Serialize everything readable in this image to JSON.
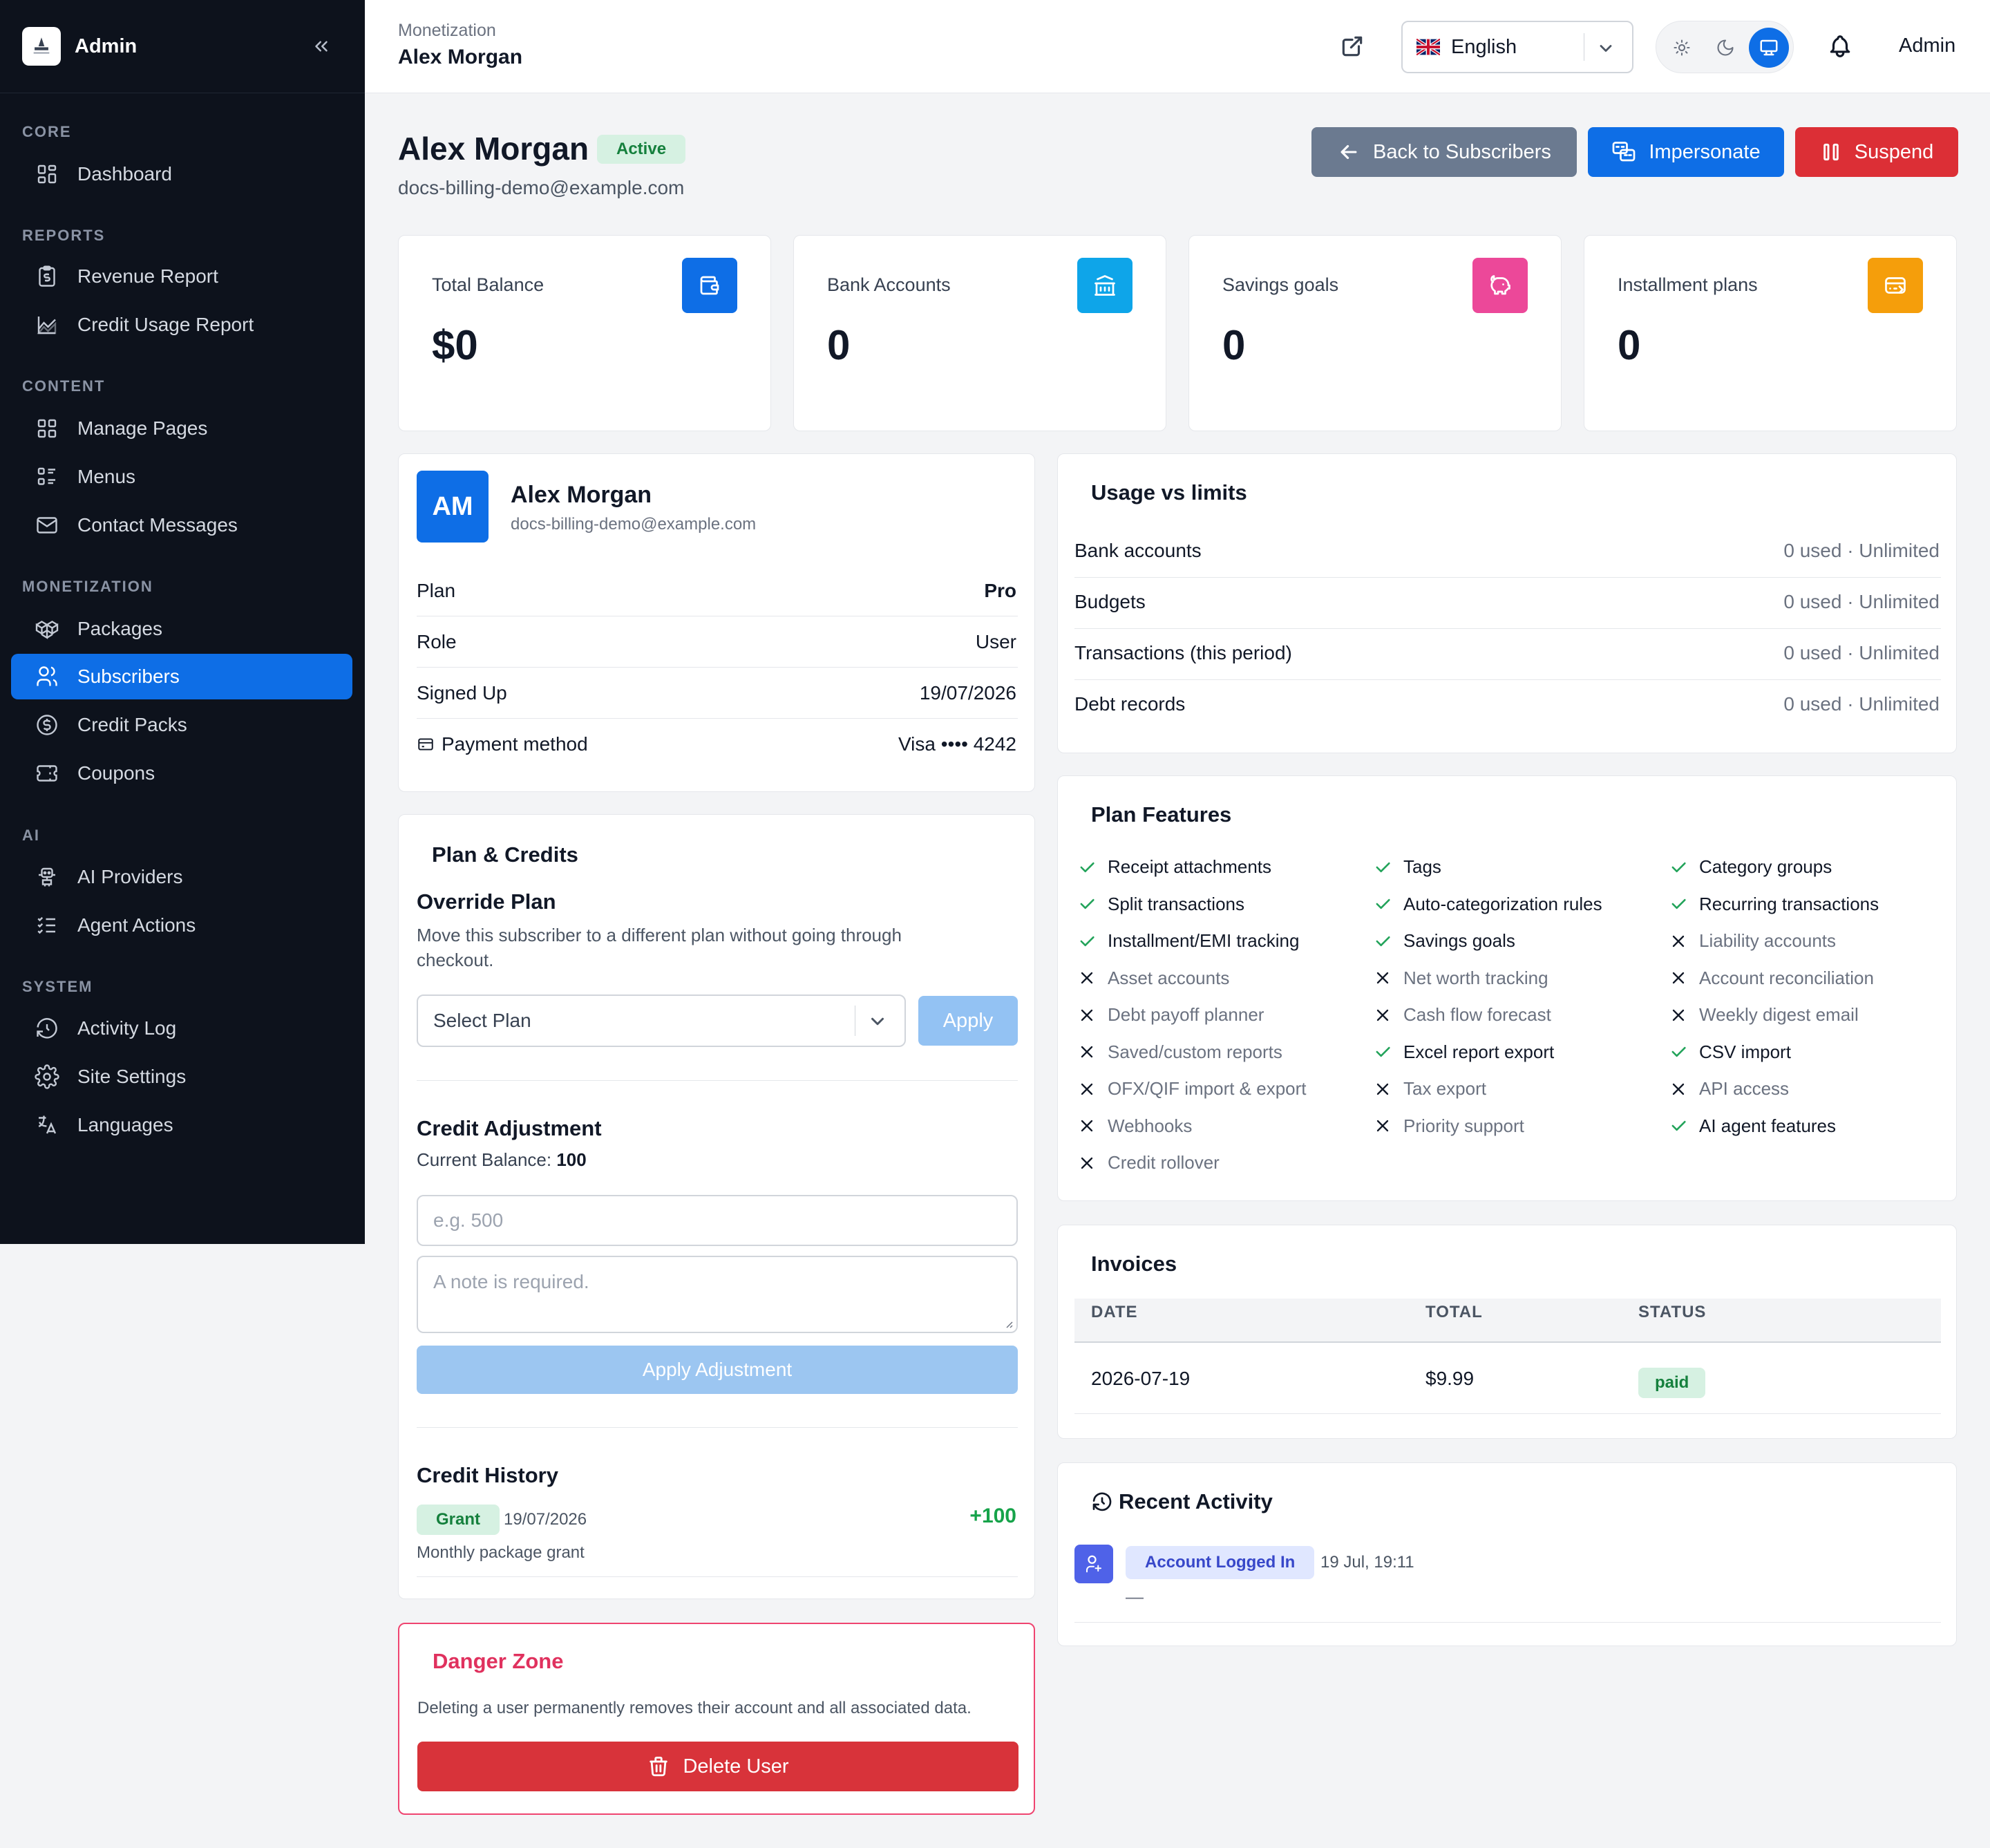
{
  "sidebar": {
    "title": "Admin",
    "sections": {
      "core": "CORE",
      "reports": "REPORTS",
      "content": "CONTENT",
      "monetization": "MONETIZATION",
      "ai": "AI",
      "system": "SYSTEM"
    },
    "items": {
      "dashboard": "Dashboard",
      "revenue": "Revenue Report",
      "credit_usage": "Credit Usage Report",
      "pages": "Manage Pages",
      "menus": "Menus",
      "contact": "Contact Messages",
      "packages": "Packages",
      "subscribers": "Subscribers",
      "credit_packs": "Credit Packs",
      "coupons": "Coupons",
      "ai_providers": "AI Providers",
      "agent_actions": "Agent Actions",
      "activity_log": "Activity Log",
      "site_settings": "Site Settings",
      "languages": "Languages"
    },
    "active_item": "Subscribers"
  },
  "topbar": {
    "breadcrumb": "Monetization",
    "page_name": "Alex Morgan",
    "language": "English",
    "theme_active": "system",
    "user": "Admin"
  },
  "header": {
    "name": "Alex Morgan",
    "status": "Active",
    "email": "docs-billing-demo@example.com",
    "buttons": {
      "back": "Back to Subscribers",
      "impersonate": "Impersonate",
      "suspend": "Suspend"
    }
  },
  "stats": [
    {
      "label": "Total Balance",
      "value": "$0",
      "icon": "wallet-icon",
      "color": "#0e6ee6"
    },
    {
      "label": "Bank Accounts",
      "value": "0",
      "icon": "bank-icon",
      "color": "#0ea5e9"
    },
    {
      "label": "Savings goals",
      "value": "0",
      "icon": "piggy-bank-icon",
      "color": "#ec4899"
    },
    {
      "label": "Installment plans",
      "value": "0",
      "icon": "card-transfer-icon",
      "color": "#f59e0b"
    }
  ],
  "profile": {
    "initials": "AM",
    "name": "Alex Morgan",
    "email": "docs-billing-demo@example.com",
    "rows": [
      {
        "label": "Plan",
        "value": "Pro"
      },
      {
        "label": "Role",
        "value": "User"
      },
      {
        "label": "Signed Up",
        "value": "19/07/2026"
      },
      {
        "label": "Payment method",
        "value": "Visa •••• 4242"
      }
    ]
  },
  "plan_credits": {
    "title": "Plan & Credits",
    "override_title": "Override Plan",
    "override_desc_line1": "Move this subscriber to a different plan without going through",
    "override_desc_line2": "checkout.",
    "select_placeholder": "Select Plan",
    "apply_label": "Apply",
    "adjust_title": "Credit Adjustment",
    "balance_label": "Current Balance:",
    "balance_value": "100",
    "amount_placeholder": "e.g. 500",
    "note_placeholder": "A note is required.",
    "apply_adjust_label": "Apply Adjustment",
    "history_title": "Credit History",
    "history": [
      {
        "type": "Grant",
        "date": "19/07/2026",
        "amount": "+100",
        "note": "Monthly package grant"
      }
    ]
  },
  "danger": {
    "title": "Danger Zone",
    "desc": "Deleting a user permanently removes their account and all associated data.",
    "button": "Delete User"
  },
  "usage": {
    "title": "Usage vs limits",
    "rows": [
      {
        "label": "Bank accounts",
        "value": "0 used · Unlimited"
      },
      {
        "label": "Budgets",
        "value": "0 used · Unlimited"
      },
      {
        "label": "Transactions (this period)",
        "value": "0 used · Unlimited"
      },
      {
        "label": "Debt records",
        "value": "0 used · Unlimited"
      }
    ]
  },
  "features": {
    "title": "Plan Features",
    "items": [
      {
        "label": "Receipt attachments",
        "enabled": true
      },
      {
        "label": "Tags",
        "enabled": true
      },
      {
        "label": "Category groups",
        "enabled": true
      },
      {
        "label": "Split transactions",
        "enabled": true
      },
      {
        "label": "Auto-categorization rules",
        "enabled": true
      },
      {
        "label": "Recurring transactions",
        "enabled": true
      },
      {
        "label": "Installment/EMI tracking",
        "enabled": true
      },
      {
        "label": "Savings goals",
        "enabled": true
      },
      {
        "label": "Liability accounts",
        "enabled": false
      },
      {
        "label": "Asset accounts",
        "enabled": false
      },
      {
        "label": "Net worth tracking",
        "enabled": false
      },
      {
        "label": "Account reconciliation",
        "enabled": false
      },
      {
        "label": "Debt payoff planner",
        "enabled": false
      },
      {
        "label": "Cash flow forecast",
        "enabled": false
      },
      {
        "label": "Weekly digest email",
        "enabled": false
      },
      {
        "label": "Saved/custom reports",
        "enabled": false
      },
      {
        "label": "Excel report export",
        "enabled": true
      },
      {
        "label": "CSV import",
        "enabled": true
      },
      {
        "label": "OFX/QIF import & export",
        "enabled": false
      },
      {
        "label": "Tax export",
        "enabled": false
      },
      {
        "label": "API access",
        "enabled": false
      },
      {
        "label": "Webhooks",
        "enabled": false
      },
      {
        "label": "Priority support",
        "enabled": false
      },
      {
        "label": "AI agent features",
        "enabled": true
      },
      {
        "label": "Credit rollover",
        "enabled": false
      }
    ]
  },
  "invoices": {
    "title": "Invoices",
    "headers": [
      "DATE",
      "TOTAL",
      "STATUS"
    ],
    "rows": [
      {
        "date": "2026-07-19",
        "total": "$9.99",
        "status": "paid"
      }
    ]
  },
  "activity": {
    "title": "Recent Activity",
    "items": [
      {
        "action": "Account Logged In",
        "time": "19 Jul, 19:11",
        "detail": "—"
      }
    ]
  },
  "colors": {
    "primary": "#0e6ee6",
    "danger": "#dc2f36",
    "success": "#15803d",
    "sidebar_bg": "#0d121c"
  }
}
